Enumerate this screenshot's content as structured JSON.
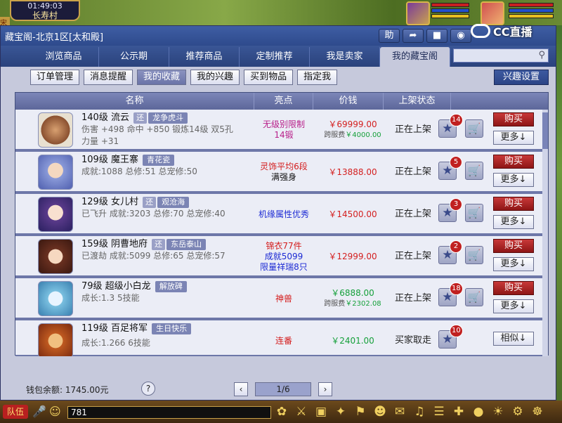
{
  "game": {
    "clock": "01:49:03",
    "location": "长寿村",
    "chat_value": "781",
    "team_label": "队伍",
    "side_label": "宋"
  },
  "overlay": {
    "brand": "CC直播"
  },
  "window": {
    "title": "藏宝阁-北京1区[太和殿]",
    "icons": [
      "help-icon",
      "share-icon",
      "stop-icon",
      "chat-icon"
    ],
    "icon_glyphs": [
      "助",
      "➦",
      "■",
      "◉"
    ]
  },
  "tabs": [
    "浏览商品",
    "公示期",
    "推荐商品",
    "定制推荐",
    "我是卖家",
    "我的藏宝阁"
  ],
  "search": {
    "placeholder": ""
  },
  "subtabs": [
    "订单管理",
    "消息提醒",
    "我的收藏",
    "我的兴趣",
    "买到物品",
    "指定我"
  ],
  "interest_settings": "兴趣设置",
  "table": {
    "headers": [
      "名称",
      "亮点",
      "价钱",
      "上架状态"
    ],
    "rows": [
      {
        "name": "140级 流云",
        "tag1": "还",
        "tag2": "龙争虎斗",
        "line2": "伤害 +498 命中 +850 锻炼14级 双5孔",
        "line3": "力量 +31",
        "hl1": "无级别限制",
        "hl2": "14锻",
        "hl_color": "#b8208a",
        "price": "￥69999.00",
        "fee_label": "跨服费",
        "fee": "￥4000.00",
        "state": "正在上架",
        "count": "14",
        "buy": "购买",
        "more": "更多↓"
      },
      {
        "name": "109级 魔王寨",
        "tag1": "",
        "tag2": "青花瓷",
        "line2": "成就:1088 总修:51 总宠修:50",
        "line3": "",
        "hl1": "灵饰平均6段",
        "hl2": "满强身",
        "hl_color": "#d41c1c",
        "price": "￥13888.00",
        "fee_label": "",
        "fee": "",
        "state": "正在上架",
        "count": "5",
        "buy": "购买",
        "more": "更多↓"
      },
      {
        "name": "129级 女儿村",
        "tag1": "还",
        "tag2": "观沧海",
        "line2": "已飞升 成就:3203 总修:70 总宠修:40",
        "line3": "",
        "hl1": "机缘属性优秀",
        "hl2": "",
        "hl_color": "#1c2ad4",
        "price": "￥14500.00",
        "fee_label": "",
        "fee": "",
        "state": "正在上架",
        "count": "3",
        "buy": "购买",
        "more": "更多↓"
      },
      {
        "name": "159级 阴曹地府",
        "tag1": "还",
        "tag2": "东岳泰山",
        "line2": "已渡劫 成就:5099 总修:65 总宠修:57",
        "line3": "",
        "hl1": "锦衣77件",
        "hl2": "成就5099",
        "hl3": "限量祥瑞8只",
        "hl_color": "#d41c1c",
        "price": "￥12999.00",
        "fee_label": "",
        "fee": "",
        "state": "正在上架",
        "count": "2",
        "buy": "购买",
        "more": "更多↓"
      },
      {
        "name": "79级 超级小白龙",
        "tag1": "",
        "tag2": "解放碑",
        "line2": "成长:1.3 5技能",
        "line3": "",
        "hl1": "神兽",
        "hl2": "",
        "hl_color": "#d41c1c",
        "price": "￥6888.00",
        "price_green": true,
        "fee_label": "跨服费",
        "fee": "￥2302.08",
        "state": "正在上架",
        "count": "18",
        "buy": "购买",
        "more": "更多↓"
      },
      {
        "name": "119级 百足将军",
        "tag1": "",
        "tag2": "生日快乐",
        "line2": "成长:1.266 6技能",
        "line3": "",
        "hl1": "连番",
        "hl2": "",
        "hl_color": "#d41c1c",
        "price": "￥2401.00",
        "price_green": true,
        "fee_label": "",
        "fee": "",
        "state": "买家取走",
        "count": "10",
        "similar": "相似↓"
      }
    ]
  },
  "footer": {
    "wallet_label": "钱包余额:",
    "wallet_value": "1745.00元",
    "page": "1/6"
  },
  "colors": {
    "accent": "#2e4a8c",
    "buy": "#b82424",
    "price": "#d42020",
    "green_price": "#15a03a"
  }
}
